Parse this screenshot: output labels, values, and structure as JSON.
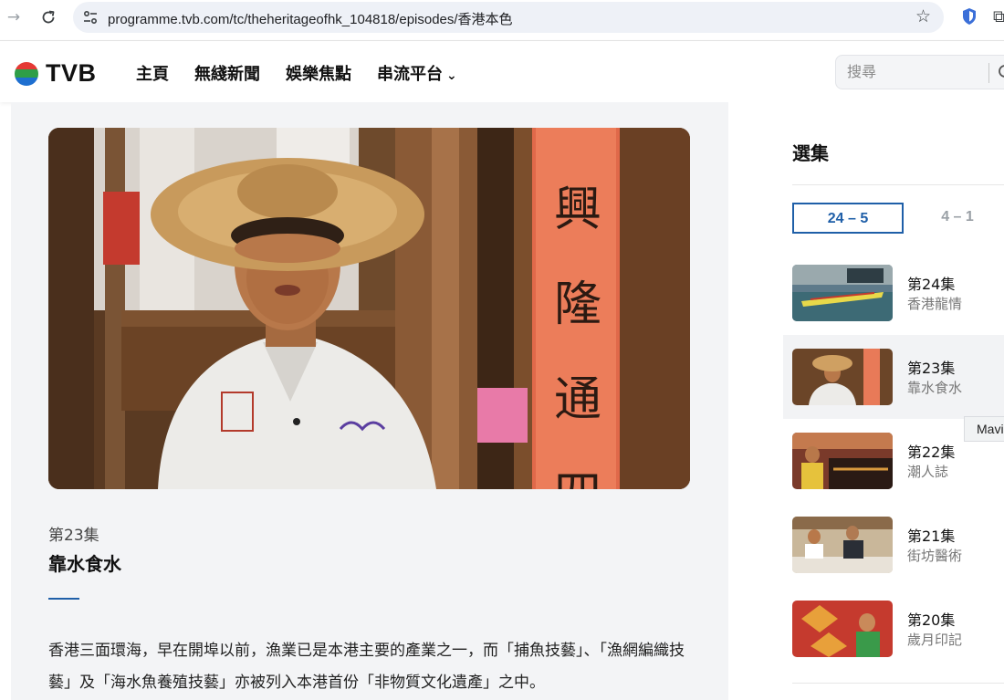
{
  "browser": {
    "url": "programme.tvb.com/tc/theheritageofhk_104818/episodes/香港本色"
  },
  "header": {
    "logo_text": "TVB",
    "nav": [
      {
        "label": "主頁"
      },
      {
        "label": "無綫新聞"
      },
      {
        "label": "娛樂焦點"
      },
      {
        "label": "串流平台"
      }
    ],
    "search_placeholder": "搜尋"
  },
  "main": {
    "episode_number": "第23集",
    "episode_title": "靠水食水",
    "description": "香港三面環海，早在開埠以前，漁業已是本港主要的產業之一，而「捕魚技藝」、「漁網編織技藝」及「海水魚養殖技藝」亦被列入本港首份「非物質文化遺產」之中。",
    "video_scroll_text": [
      "興",
      "隆",
      "通",
      "四"
    ]
  },
  "sidebar": {
    "title": "選集",
    "ranges": [
      {
        "label": "24 – 5",
        "active": true
      },
      {
        "label": "4 – 1",
        "active": false
      }
    ],
    "episodes": [
      {
        "number": "第24集",
        "title": "香港龍情"
      },
      {
        "number": "第23集",
        "title": "靠水食水"
      },
      {
        "number": "第22集",
        "title": "潮人誌"
      },
      {
        "number": "第21集",
        "title": "街坊醫術"
      },
      {
        "number": "第20集",
        "title": "歲月印記"
      }
    ]
  },
  "tooltip": {
    "text": "Mavi"
  },
  "colors": {
    "accent": "#1f5fa8",
    "panel_bg": "#f3f4f6"
  }
}
